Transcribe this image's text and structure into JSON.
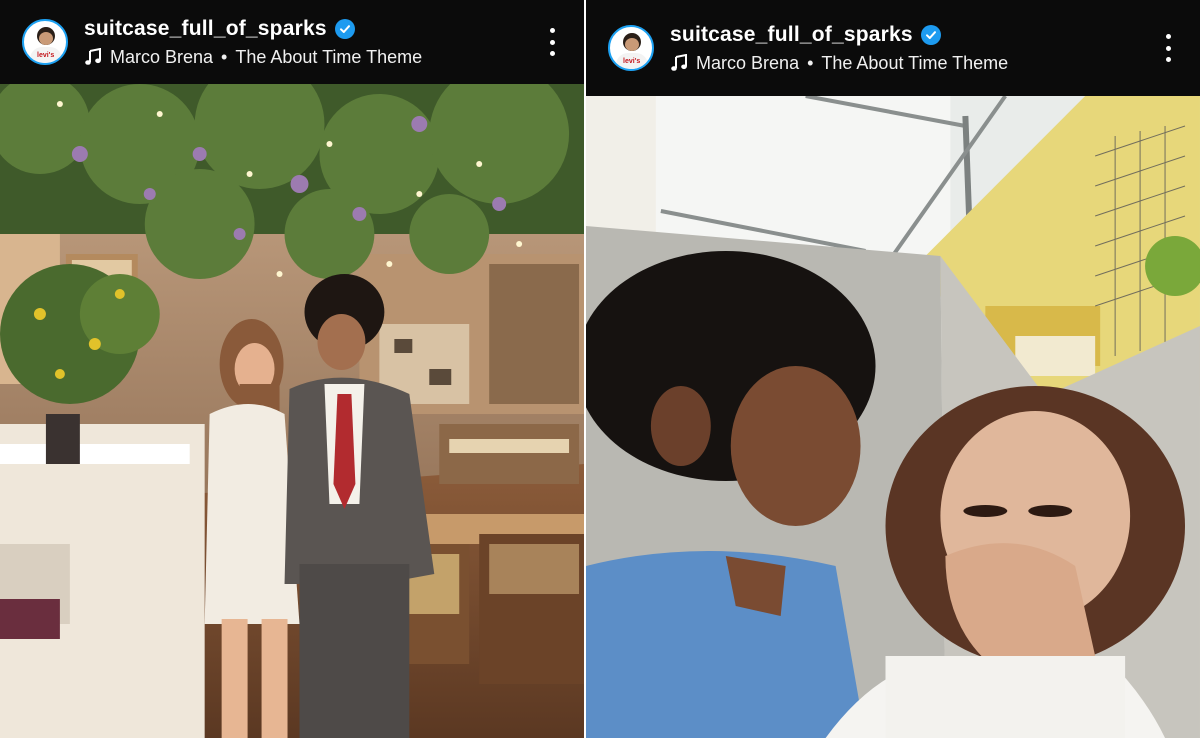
{
  "posts": [
    {
      "username": "suitcase_full_of_sparks",
      "music_artist": "Marco Brena",
      "music_separator": "•",
      "music_track": "The About Time Theme",
      "avatar_logo": "levi's",
      "icons": {
        "verified": "verified-badge-icon",
        "music": "music-note-icon",
        "more": "more-options-icon"
      }
    },
    {
      "username": "suitcase_full_of_sparks",
      "music_artist": "Marco Brena",
      "music_separator": "•",
      "music_track": "The About Time Theme",
      "avatar_logo": "levi's",
      "icons": {
        "verified": "verified-badge-icon",
        "music": "music-note-icon",
        "more": "more-options-icon"
      }
    }
  ],
  "colors": {
    "header_bg": "#0b0b0b",
    "verified_blue": "#1d9bf0"
  }
}
